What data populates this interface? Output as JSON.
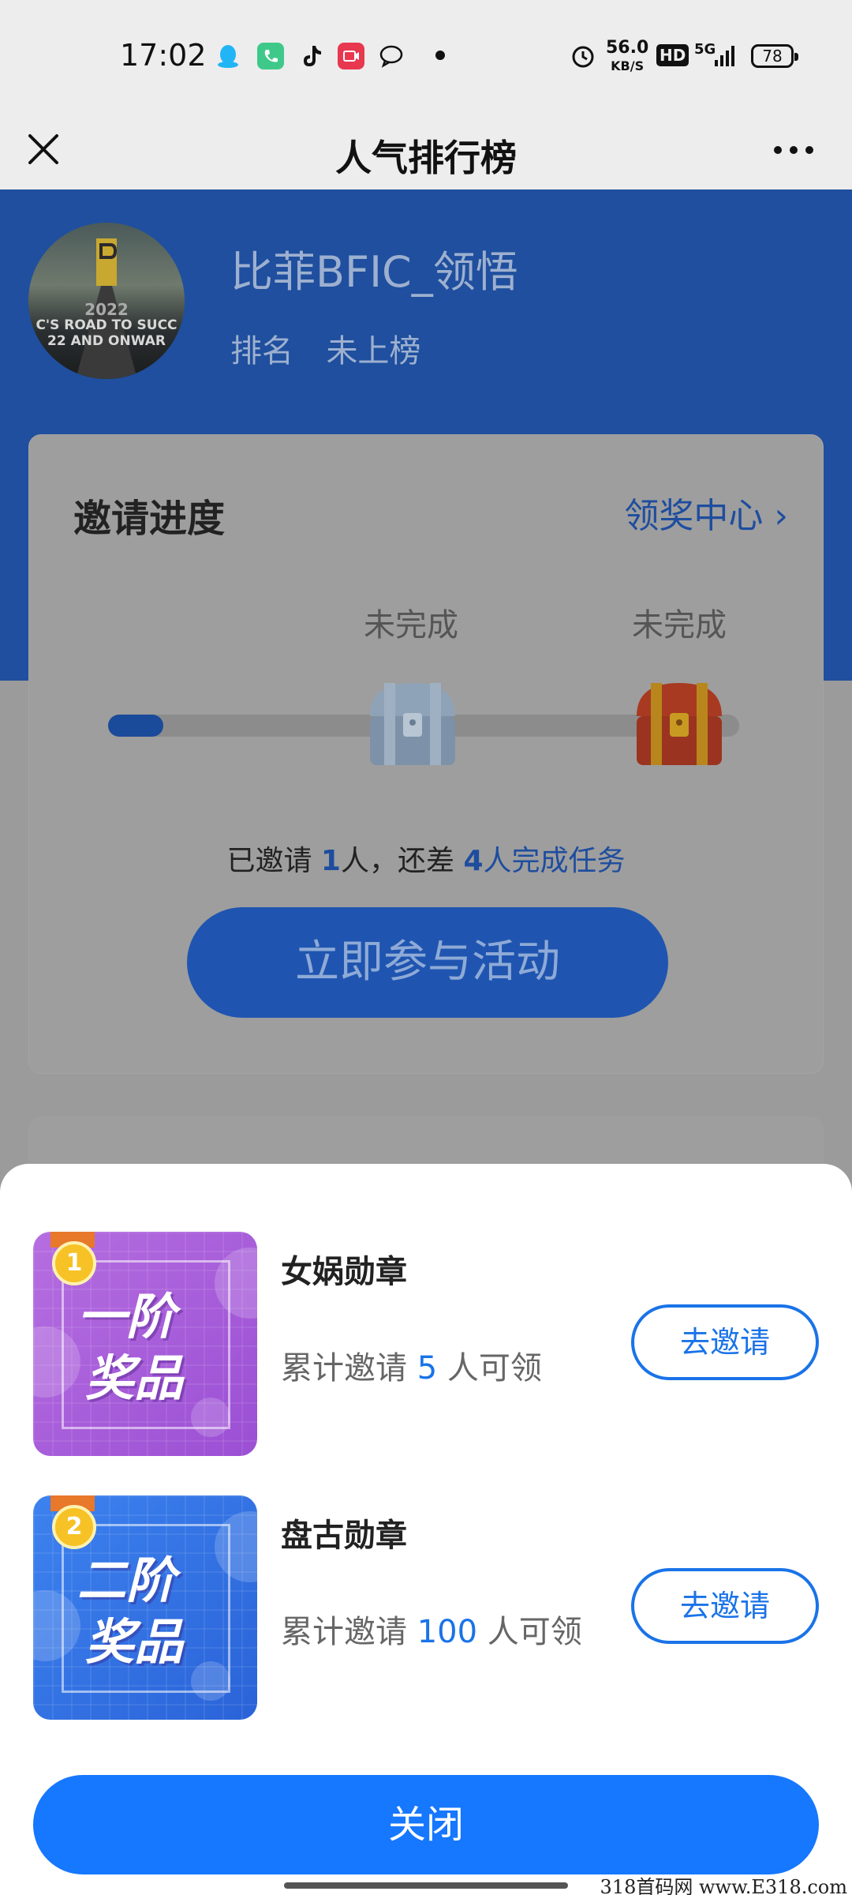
{
  "status_bar": {
    "time": "17:02",
    "speed_value": "56.0",
    "speed_unit": "KB/S",
    "hd": "HD",
    "network": "5G",
    "battery": "78"
  },
  "header": {
    "title": "人气排行榜",
    "close_icon": "close-icon",
    "more_icon": "more-icon"
  },
  "profile": {
    "avatar_caption": "C'S ROAD TO SUCC\n22 AND ONWAR",
    "avatar_year": "2022",
    "name": "比菲BFIC_领悟",
    "rank_label": "排名",
    "rank_value": "未上榜"
  },
  "invite_card": {
    "title": "邀请进度",
    "reward_center": "领奖中心 ›",
    "stages": [
      {
        "label": "未完成",
        "chest": "silver-chest-icon"
      },
      {
        "label": "未完成",
        "chest": "gold-chest-icon"
      }
    ],
    "progress": {
      "prefix": "已邀请 ",
      "invited": "1",
      "middle1": "人，还差 ",
      "remaining": "4",
      "suffix": "人完成任务"
    },
    "join_button": "立即参与活动"
  },
  "sheet": {
    "prizes": [
      {
        "badge_number": "1",
        "image_line1": "一阶",
        "image_line2": "奖品",
        "name": "女娲勋章",
        "desc_prefix": "累计邀请 ",
        "count": "5",
        "desc_suffix": " 人可领",
        "button": "去邀请"
      },
      {
        "badge_number": "2",
        "image_line1": "二阶",
        "image_line2": "奖品",
        "name": "盘古勋章",
        "desc_prefix": "累计邀请 ",
        "count": "100",
        "desc_suffix": " 人可领",
        "button": "去邀请"
      }
    ],
    "close_button": "关闭"
  },
  "watermark": "318首码网 www.E318.com",
  "colors": {
    "accent": "#1677ff",
    "link": "#1a73e8",
    "prize1_bg": "#a45cd8",
    "prize2_bg": "#336fe3"
  }
}
